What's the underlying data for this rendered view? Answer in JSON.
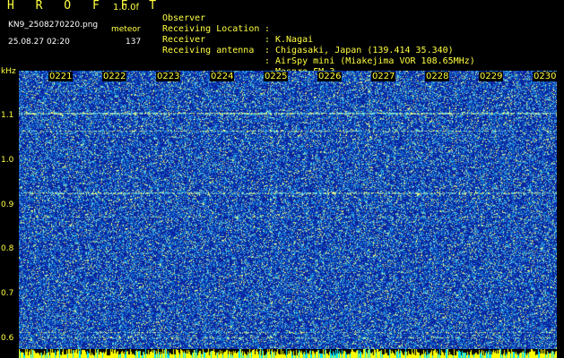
{
  "header": {
    "app_title": "H R O F F T",
    "version": "1.0.0f",
    "filename": "KN9_2508270220.png",
    "mode": "meteor",
    "datetime": "25.08.27 02:20",
    "count": "137"
  },
  "info": [
    {
      "label": "Observer",
      "sep": ":",
      "value": "K.Nagai"
    },
    {
      "label": "Receiving Location",
      "sep": ":",
      "value": "Chigasaki, Japan (139.414 35.340)"
    },
    {
      "label": "Receiver",
      "sep": ":",
      "value": "AirSpy mini (Miakejima VOR 108.65MHz)"
    },
    {
      "label": "Receiving antenna",
      "sep": ":",
      "value": "Maspro FM-3"
    }
  ],
  "spectrogram": {
    "y_unit": "kHz",
    "y_ticks": [
      "1.1",
      "1.0",
      "0.9",
      "0.8",
      "0.7",
      "0.6"
    ],
    "x_ticks": [
      "0221",
      "0222",
      "0223",
      "0224",
      "0225",
      "0226",
      "0227",
      "0228",
      "0229",
      "0230"
    ],
    "colors": {
      "background": "#000000",
      "noise_base": "#1c36b8",
      "text": "#ffff40",
      "signal": "#40e0ff",
      "level_bar": "#ffff00"
    }
  }
}
